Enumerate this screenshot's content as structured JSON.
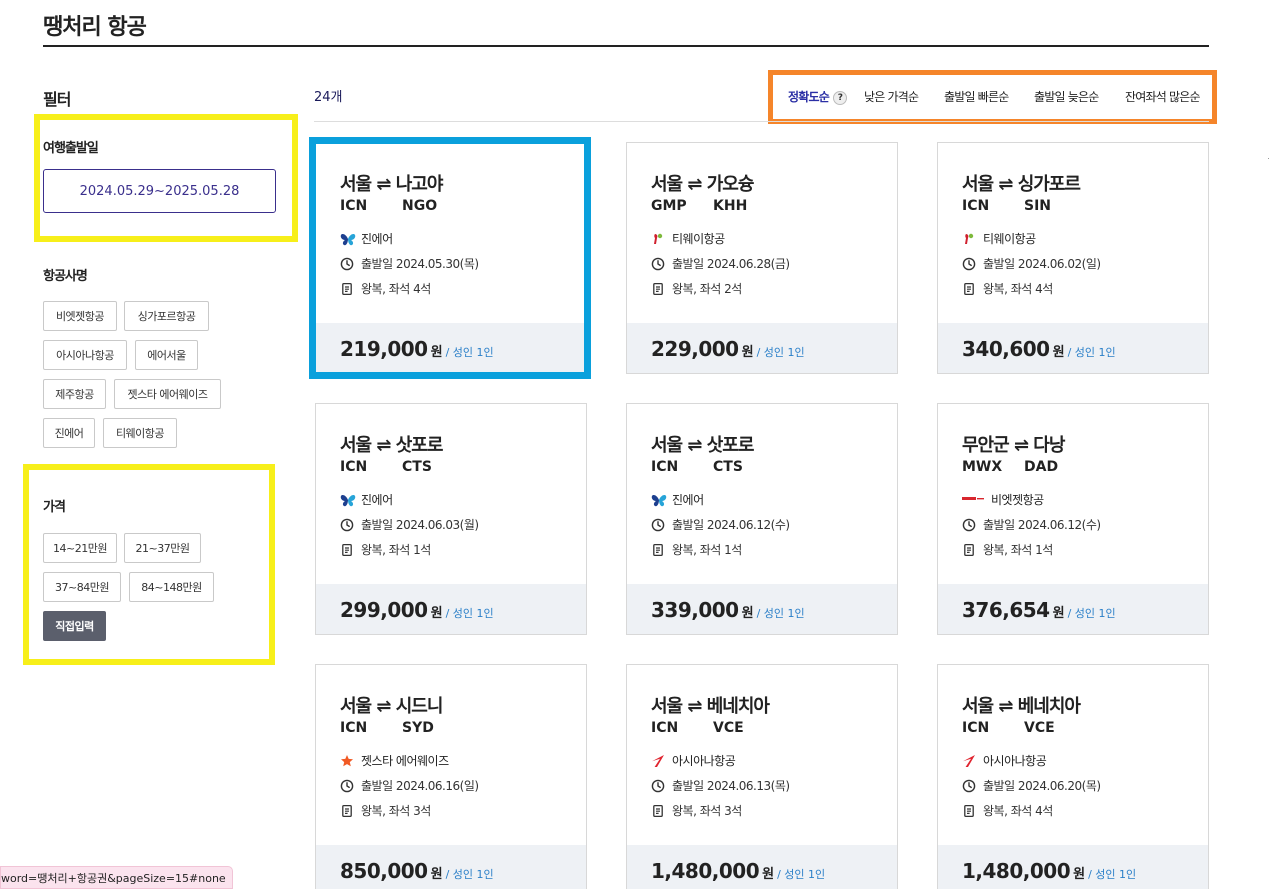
{
  "header": {
    "title": "땡처리 항공"
  },
  "filters": {
    "heading": "필터",
    "date": {
      "title": "여행출발일",
      "value": "2024.05.29~2025.05.28"
    },
    "airlines": {
      "title": "항공사명",
      "chips": [
        "비엣젯항공",
        "싱가포르항공",
        "아시아나항공",
        "에어서울",
        "제주항공",
        "젯스타 에어웨이즈",
        "진에어",
        "티웨이항공"
      ]
    },
    "price": {
      "title": "가격",
      "chips": [
        "14~21만원",
        "21~37만원",
        "37~84만원",
        "84~148만원"
      ],
      "custom_label": "직접입력"
    }
  },
  "results": {
    "count": "24개"
  },
  "sort": {
    "options": [
      "정확도순",
      "낮은 가격순",
      "출발일 빠른순",
      "출발일 늦은순",
      "잔여좌석 많은순"
    ],
    "help": "?"
  },
  "cards": [
    {
      "route": "서울 ⇌ 나고야",
      "from": "ICN",
      "to": "NGO",
      "airline": "진에어",
      "airline_icon": "butterfly-icon",
      "date": "출발일 2024.05.30(목)",
      "seats": "왕복, 좌석 4석",
      "price": "219,000",
      "unit": "원",
      "per": "/ 성인 1인"
    },
    {
      "route": "서울 ⇌ 가오슝",
      "from": "GMP",
      "to": "KHH",
      "airline": "티웨이항공",
      "airline_icon": "tway-icon",
      "date": "출발일 2024.06.28(금)",
      "seats": "왕복, 좌석 2석",
      "price": "229,000",
      "unit": "원",
      "per": "/ 성인 1인"
    },
    {
      "route": "서울 ⇌ 싱가포르",
      "from": "ICN",
      "to": "SIN",
      "airline": "티웨이항공",
      "airline_icon": "tway-icon",
      "date": "출발일 2024.06.02(일)",
      "seats": "왕복, 좌석 4석",
      "price": "340,600",
      "unit": "원",
      "per": "/ 성인 1인"
    },
    {
      "route": "서울 ⇌ 삿포로",
      "from": "ICN",
      "to": "CTS",
      "airline": "진에어",
      "airline_icon": "butterfly-icon",
      "date": "출발일 2024.06.03(월)",
      "seats": "왕복, 좌석 1석",
      "price": "299,000",
      "unit": "원",
      "per": "/ 성인 1인"
    },
    {
      "route": "서울 ⇌ 삿포로",
      "from": "ICN",
      "to": "CTS",
      "airline": "진에어",
      "airline_icon": "butterfly-icon",
      "date": "출발일 2024.06.12(수)",
      "seats": "왕복, 좌석 1석",
      "price": "339,000",
      "unit": "원",
      "per": "/ 성인 1인"
    },
    {
      "route": "무안군 ⇌ 다낭",
      "from": "MWX",
      "to": "DAD",
      "airline": "비엣젯항공",
      "airline_icon": "vietjet-icon",
      "date": "출발일 2024.06.12(수)",
      "seats": "왕복, 좌석 1석",
      "price": "376,654",
      "unit": "원",
      "per": "/ 성인 1인"
    },
    {
      "route": "서울 ⇌ 시드니",
      "from": "ICN",
      "to": "SYD",
      "airline": "젯스타 에어웨이즈",
      "airline_icon": "star-icon",
      "date": "출발일 2024.06.16(일)",
      "seats": "왕복, 좌석 3석",
      "price": "850,000",
      "unit": "원",
      "per": "/ 성인 1인"
    },
    {
      "route": "서울 ⇌ 베네치아",
      "from": "ICN",
      "to": "VCE",
      "airline": "아시아나항공",
      "airline_icon": "asiana-icon",
      "date": "출발일 2024.06.13(목)",
      "seats": "왕복, 좌석 3석",
      "price": "1,480,000",
      "unit": "원",
      "per": "/ 성인 1인"
    },
    {
      "route": "서울 ⇌ 베네치아",
      "from": "ICN",
      "to": "VCE",
      "airline": "아시아나항공",
      "airline_icon": "asiana-icon",
      "date": "출발일 2024.06.20(목)",
      "seats": "왕복, 좌석 4석",
      "price": "1,480,000",
      "unit": "원",
      "per": "/ 성인 1인"
    }
  ],
  "status_url": "word=땡처리+항공권&pageSize=15#none",
  "colors": {
    "highlight_yellow": "#f7ef1a",
    "highlight_orange": "#f5852a",
    "highlight_blue": "#0aa0dc",
    "accent": "#3a2f8c"
  }
}
